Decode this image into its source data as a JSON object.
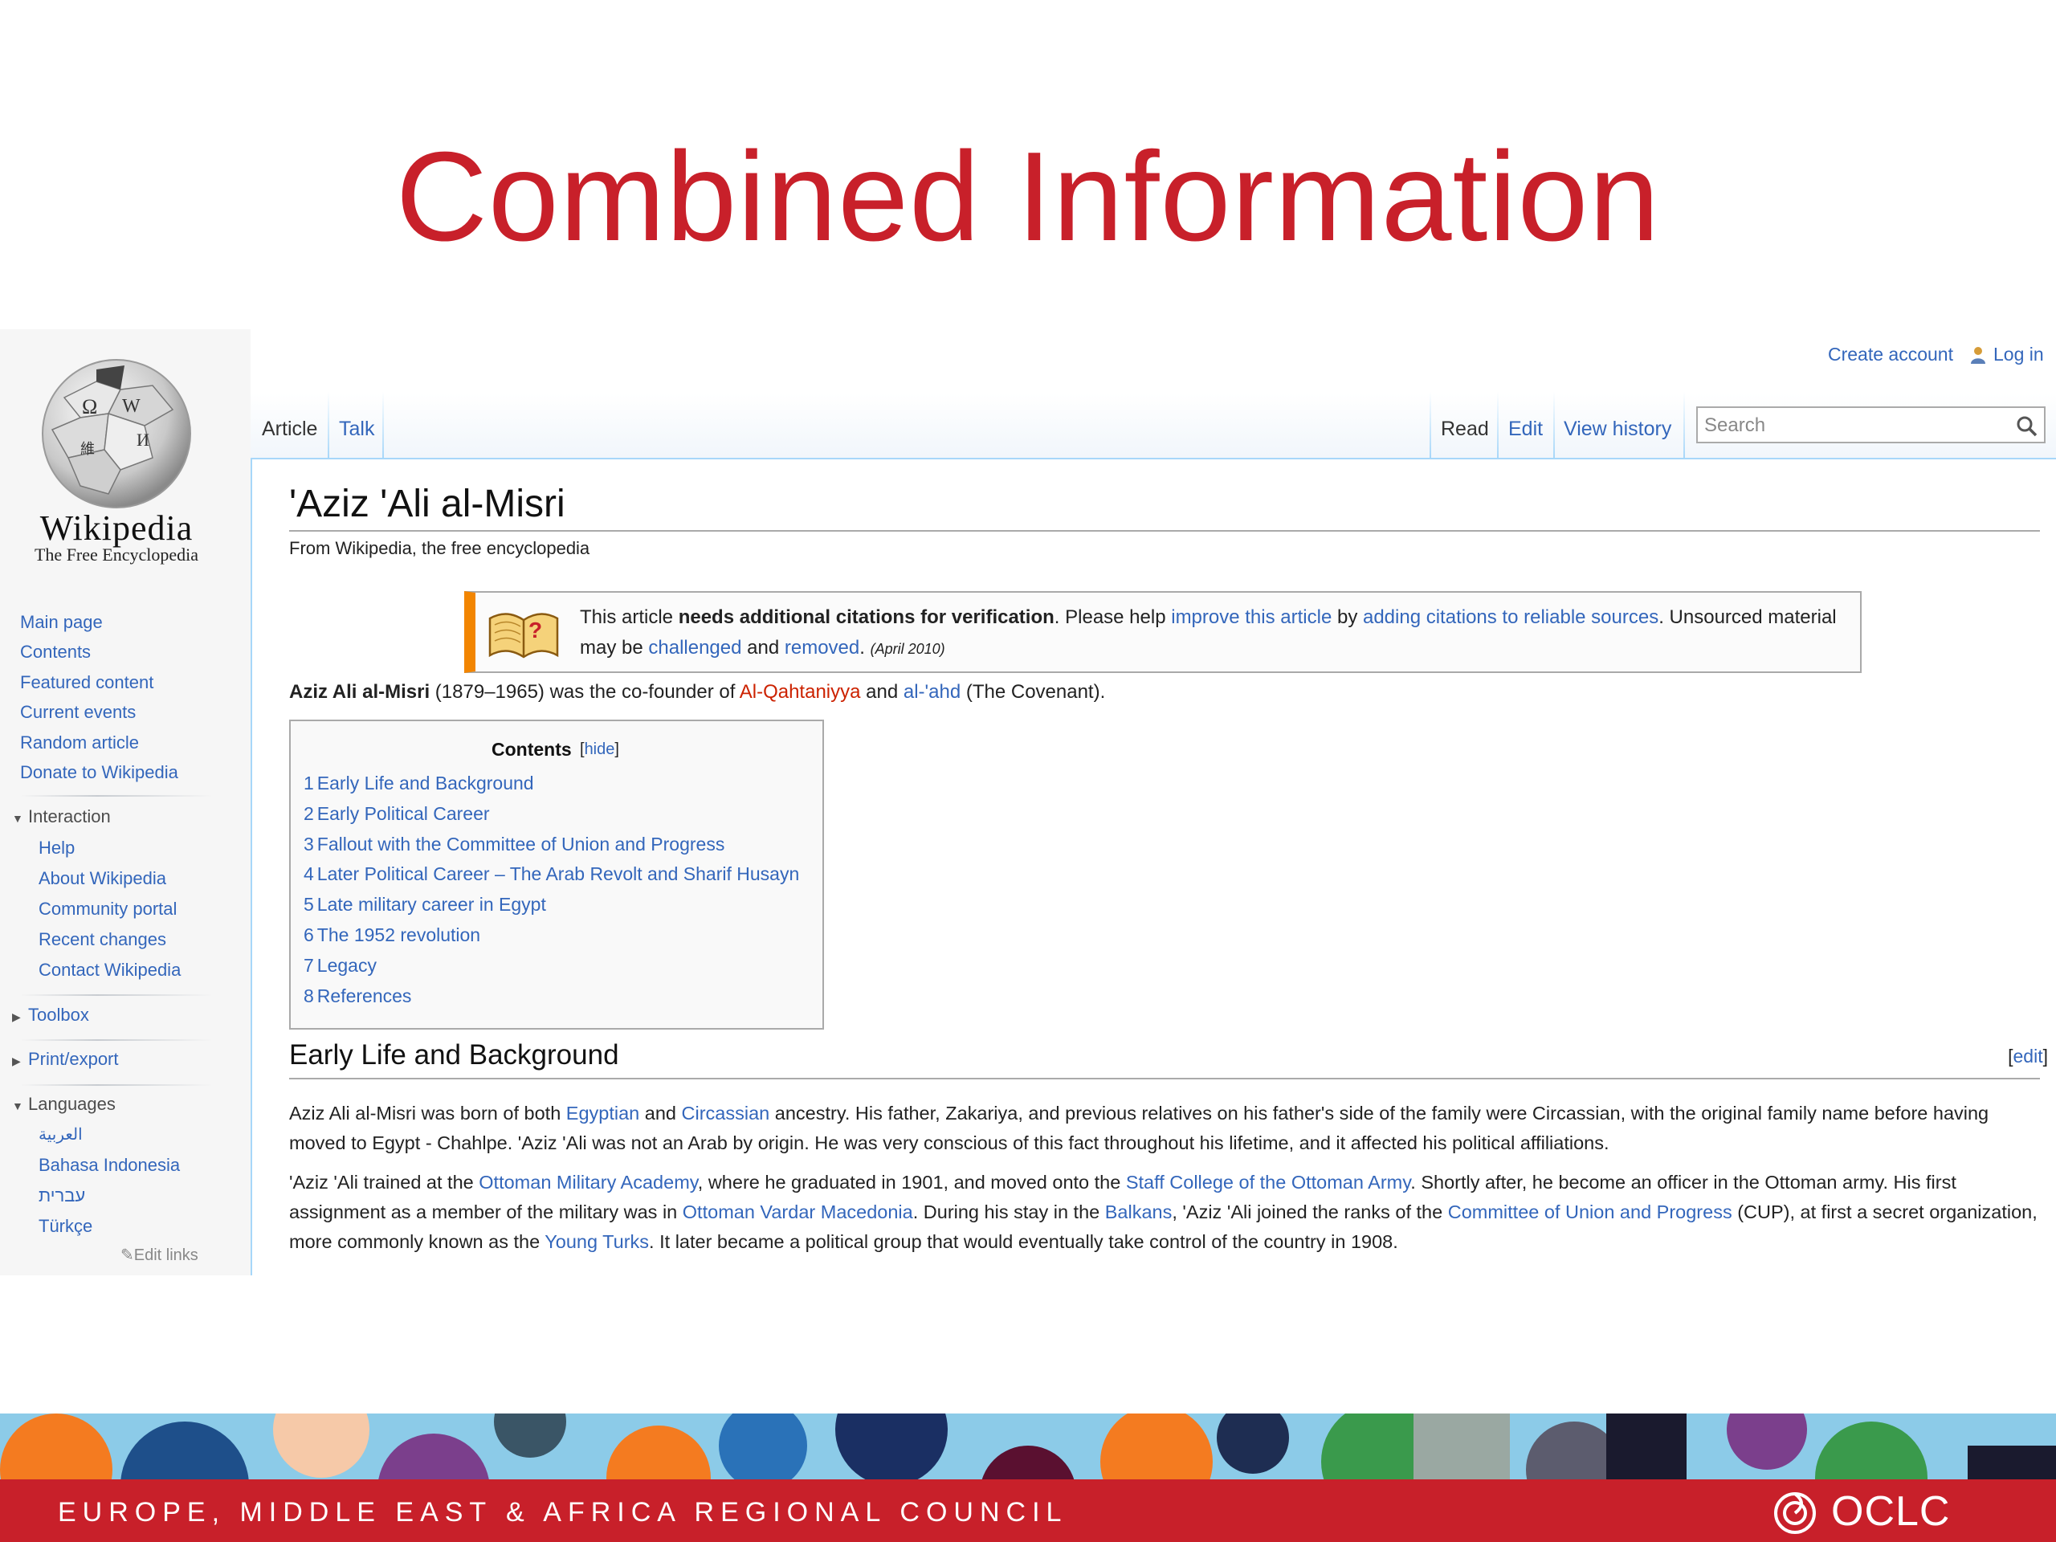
{
  "slide": {
    "title": "Combined Information"
  },
  "sidebar": {
    "logo": {
      "title": "Wikipedia",
      "subtitle": "The Free Encyclopedia"
    },
    "nav": [
      "Main page",
      "Contents",
      "Featured content",
      "Current events",
      "Random article",
      "Donate to Wikipedia"
    ],
    "interaction": {
      "heading": "Interaction",
      "items": [
        "Help",
        "About Wikipedia",
        "Community portal",
        "Recent changes",
        "Contact Wikipedia"
      ]
    },
    "toolbox": "Toolbox",
    "print_export": "Print/export",
    "languages": {
      "heading": "Languages",
      "items": [
        "العربية",
        "Bahasa Indonesia",
        "עברית",
        "Türkçe"
      ]
    },
    "edit_links": "Edit links"
  },
  "header": {
    "create_account": "Create account",
    "log_in": "Log in",
    "tabs_left": [
      "Article",
      "Talk"
    ],
    "tabs_right": [
      "Read",
      "Edit",
      "View history"
    ],
    "search_placeholder": "Search"
  },
  "article": {
    "title": "'Aziz 'Ali al-Misri",
    "tagline": "From Wikipedia, the free encyclopedia",
    "notice": {
      "t1": "This article ",
      "bold": "needs additional citations for verification",
      "t2": ". Please help ",
      "link1": "improve this article",
      "t3": " by ",
      "link2": "adding citations to reliable sources",
      "t4": ". Unsourced material may be ",
      "link3": "challenged",
      "t5": " and ",
      "link4": "removed",
      "t6": ". ",
      "date": "(April 2010)"
    },
    "lead": {
      "bold": "Aziz Ali al-Misri",
      "t1": " (1879–1965) was the co-founder of ",
      "link1": "Al-Qahtaniyya",
      "t2": " and ",
      "link2": "al-'ahd",
      "t3": " (The Covenant)."
    },
    "toc": {
      "title": "Contents",
      "hide": "hide",
      "items": [
        {
          "num": "1",
          "label": "Early Life and Background"
        },
        {
          "num": "2",
          "label": "Early Political Career"
        },
        {
          "num": "3",
          "label": "Fallout with the Committee of Union and Progress"
        },
        {
          "num": "4",
          "label": "Later Political Career – The Arab Revolt and Sharif Husayn"
        },
        {
          "num": "5",
          "label": "Late military career in Egypt"
        },
        {
          "num": "6",
          "label": "The 1952 revolution"
        },
        {
          "num": "7",
          "label": "Legacy"
        },
        {
          "num": "8",
          "label": "References"
        }
      ]
    },
    "section": {
      "heading": "Early Life and Background",
      "edit": "edit",
      "p1": {
        "t1": "Aziz Ali al-Misri was born of both ",
        "link1": "Egyptian",
        "t2": " and ",
        "link2": "Circassian",
        "t3": " ancestry. His father, Zakariya, and previous relatives on his father's side of the family were Circassian, with the original family name before having moved to Egypt - Chahlpe. 'Aziz 'Ali was not an Arab by origin. He was very conscious of this fact throughout his lifetime, and it affected his political affiliations."
      },
      "p2": {
        "t1": "'Aziz 'Ali trained at the ",
        "link1": "Ottoman Military Academy",
        "t2": ", where he graduated in 1901, and moved onto the ",
        "link2": "Staff College of the Ottoman Army",
        "t3": ". Shortly after, he become an officer in the Ottoman army. His first assignment as a member of the military was in ",
        "link3": "Ottoman Vardar Macedonia",
        "t4": ". During his stay in the ",
        "link4": "Balkans",
        "t5": ", 'Aziz 'Ali joined the ranks of the ",
        "link5": "Committee of Union and Progress",
        "t6": " (CUP), at first a secret organization, more commonly known as the ",
        "link6": "Young Turks",
        "t7": ". It later became a political group that would eventually take control of the country in 1908."
      }
    }
  },
  "footer": {
    "council": "EUROPE, MIDDLE EAST & AFRICA REGIONAL COUNCIL",
    "brand": "OCLC"
  },
  "colors": {
    "title_red": "#c8202a",
    "link_blue": "#3366bb",
    "redlink": "#cc2200",
    "notice_orange": "#f28500"
  }
}
